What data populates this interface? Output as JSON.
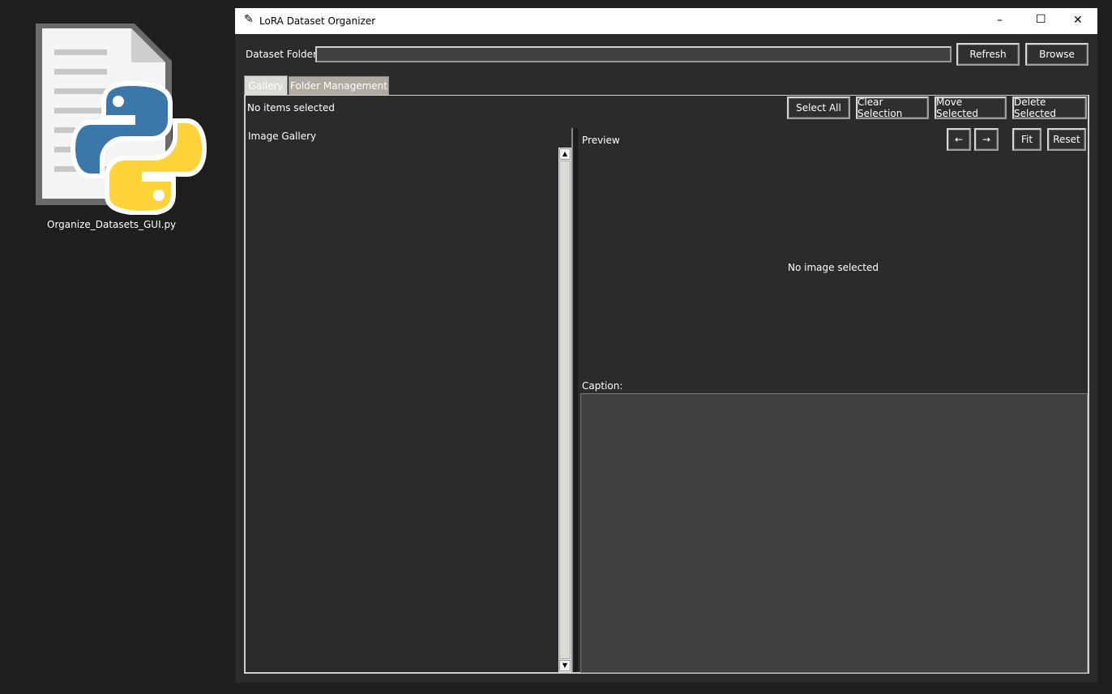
{
  "desktop": {
    "file_label": "Organize_Datasets_GUI.py"
  },
  "window": {
    "title": "LoRA Dataset Organizer",
    "controls": {
      "minimize": "–",
      "maximize": "☐",
      "close": "✕"
    }
  },
  "toolbar": {
    "folder_label": "Dataset Folder:",
    "folder_value": "",
    "refresh": "Refresh",
    "browse": "Browse"
  },
  "tabs": [
    {
      "label": "Gallery",
      "active": true
    },
    {
      "label": "Folder Management",
      "active": false
    }
  ],
  "gallery": {
    "status": "No items selected",
    "select_all": "Select All",
    "clear_selection": "Clear Selection",
    "move_selected": "Move Selected",
    "delete_selected": "Delete Selected",
    "title": "Image Gallery"
  },
  "preview": {
    "title": "Preview",
    "prev": "←",
    "next": "→",
    "fit": "Fit",
    "reset": "Reset",
    "empty": "No image selected",
    "caption_label": "Caption:",
    "caption_value": ""
  }
}
